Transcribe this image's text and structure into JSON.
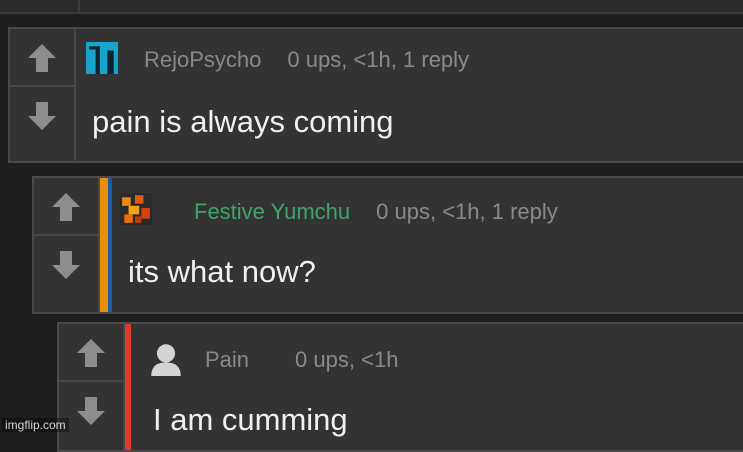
{
  "comments": [
    {
      "username": "RejoPsycho",
      "ups": "0 ups",
      "time": "<1h",
      "replies": "1 reply",
      "body": "pain is always coming",
      "bar_color": "none",
      "avatar": "teal-pixel-avatar"
    },
    {
      "username": "Festive Yumchu",
      "ups": "0 ups",
      "time": "<1h",
      "replies": "1 reply",
      "body": "its what now?",
      "bar_color": "#e8900a",
      "avatar": "orange-pixel-avatar"
    },
    {
      "username": "Pain",
      "ups": "0 ups",
      "time": "<1h",
      "replies": "",
      "body": "I am cumming",
      "bar_color": "#e03a2e",
      "avatar": "default-user-avatar"
    }
  ],
  "separator": ", ",
  "icons": {
    "upvote": "up-arrow-icon",
    "downvote": "down-arrow-icon"
  },
  "colors": {
    "background": "#1e1e1e",
    "panel": "#333333",
    "teal": "#1aa0c8",
    "green_username": "#3fa46a"
  },
  "watermark": "imgflip.com"
}
